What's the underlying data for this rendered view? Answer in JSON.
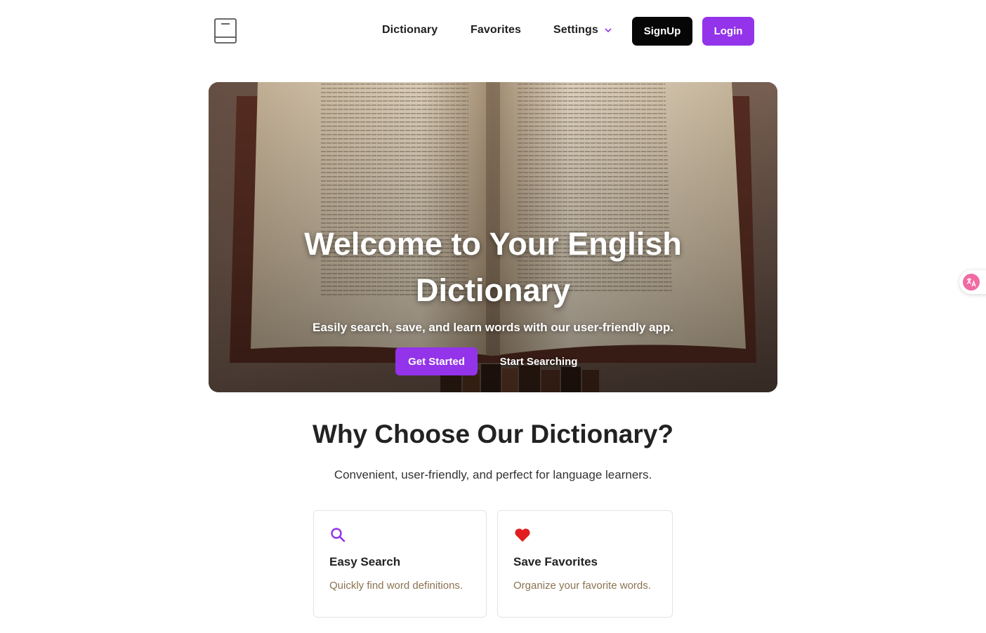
{
  "header": {
    "nav": {
      "dictionary": "Dictionary",
      "favorites": "Favorites",
      "settings": "Settings"
    },
    "signup_label": "SignUp",
    "login_label": "Login"
  },
  "hero": {
    "title_line1": "Welcome to Your English",
    "title_line2": "Dictionary",
    "subtitle": "Easily search, save, and learn words with our user-friendly app.",
    "get_started_label": "Get Started",
    "start_searching_label": "Start Searching"
  },
  "why": {
    "title": "Why Choose Our Dictionary?",
    "subtitle": "Convenient, user-friendly, and perfect for language learners."
  },
  "features": [
    {
      "icon": "search-icon",
      "title": "Easy Search",
      "text": "Quickly find word definitions."
    },
    {
      "icon": "heart-icon",
      "title": "Save Favorites",
      "text": "Organize your favorite words."
    }
  ],
  "colors": {
    "accent": "#9333ea",
    "signup_bg": "#060606",
    "heart": "#e11d1d",
    "feature_text": "#8a7350"
  }
}
